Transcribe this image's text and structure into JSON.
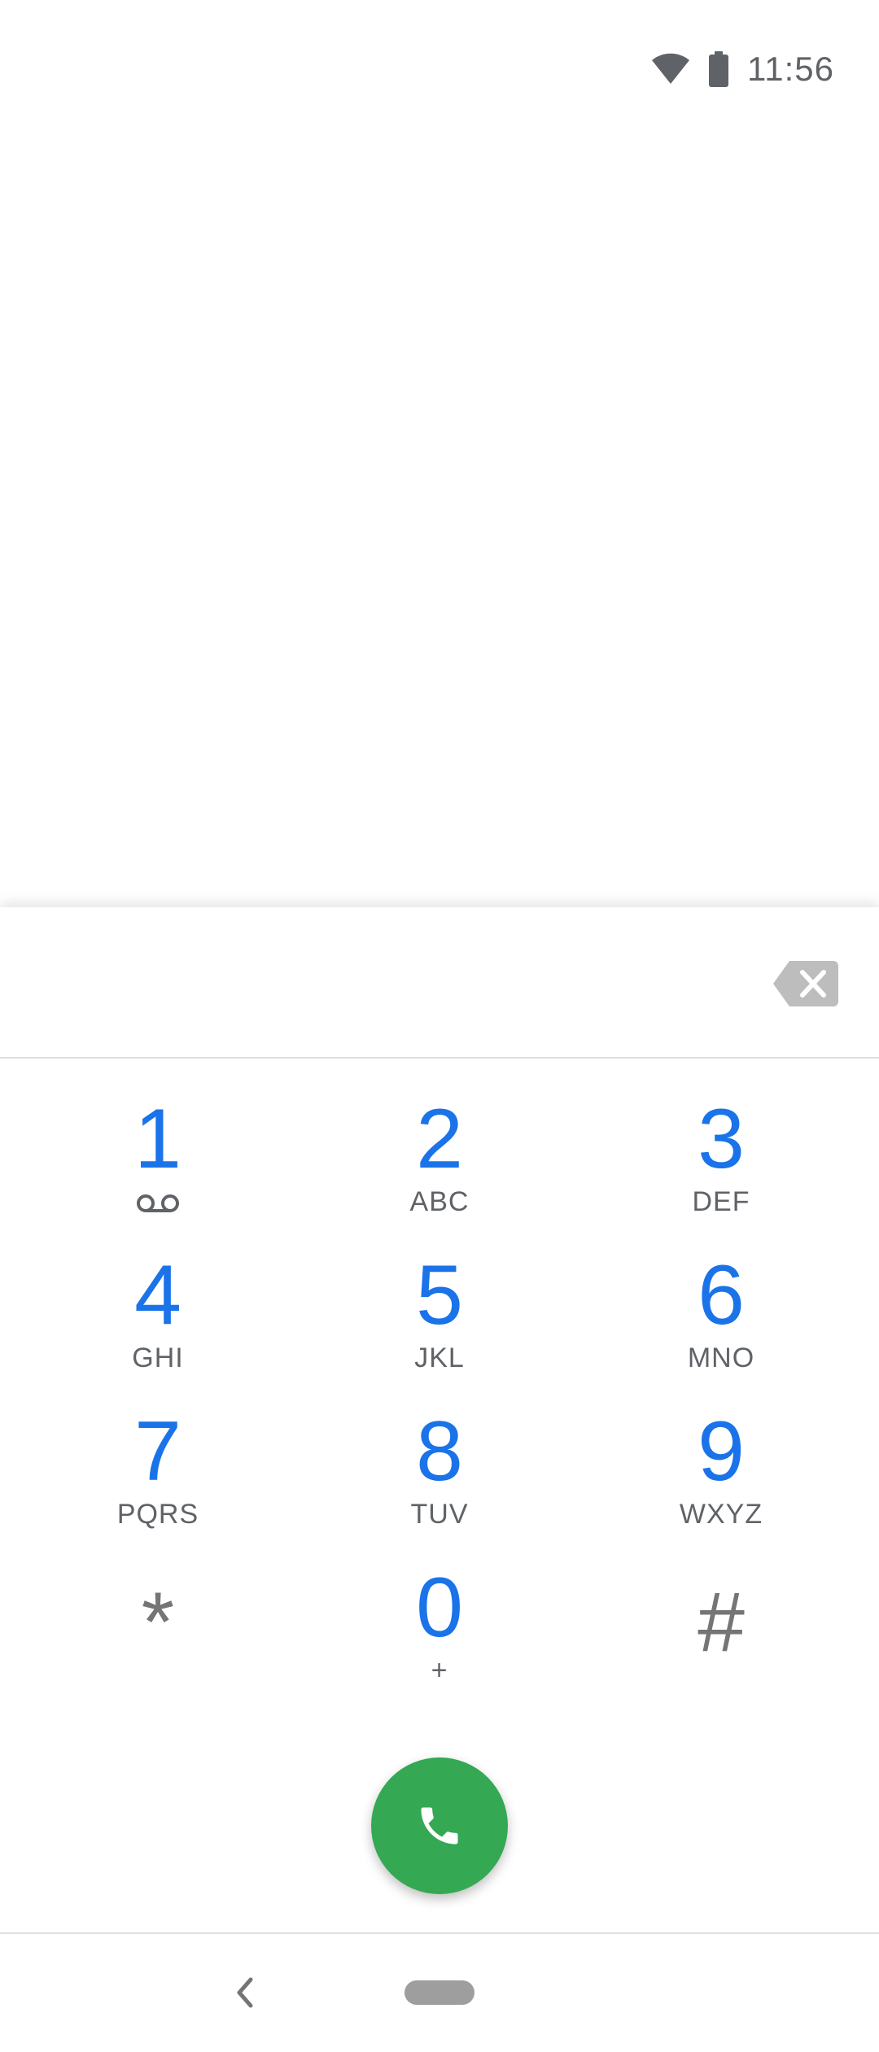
{
  "status_bar": {
    "time": "11:56",
    "icons": [
      "wifi-icon",
      "battery-icon"
    ]
  },
  "dialpad": {
    "input_value": "",
    "backspace_icon": "backspace-icon",
    "keys": [
      {
        "digit": "1",
        "letters": "",
        "icon": "voicemail-icon"
      },
      {
        "digit": "2",
        "letters": "ABC"
      },
      {
        "digit": "3",
        "letters": "DEF"
      },
      {
        "digit": "4",
        "letters": "GHI"
      },
      {
        "digit": "5",
        "letters": "JKL"
      },
      {
        "digit": "6",
        "letters": "MNO"
      },
      {
        "digit": "7",
        "letters": "PQRS"
      },
      {
        "digit": "8",
        "letters": "TUV"
      },
      {
        "digit": "9",
        "letters": "WXYZ"
      },
      {
        "digit": "*",
        "letters": ""
      },
      {
        "digit": "0",
        "letters": "+"
      },
      {
        "digit": "#",
        "letters": ""
      }
    ]
  },
  "call_button": {
    "icon": "phone-icon",
    "color": "#34a853"
  },
  "nav_bar": {
    "back_icon": "back-chevron-icon",
    "home_icon": "home-pill-icon"
  },
  "colors": {
    "digit": "#1a73e8",
    "letters": "#5f6368",
    "call": "#34a853"
  }
}
